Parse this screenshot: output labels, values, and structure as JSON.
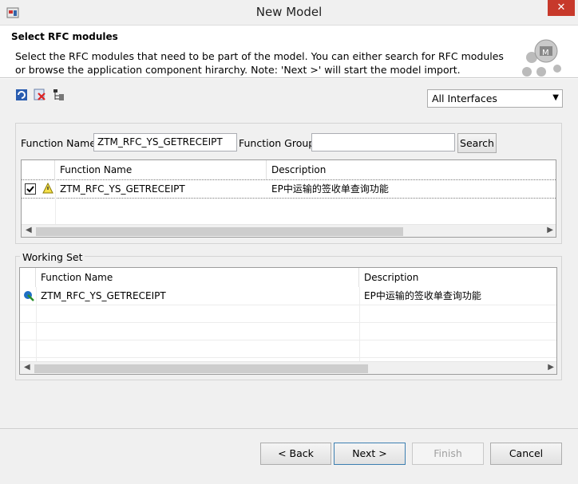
{
  "window": {
    "title": "New Model",
    "close_glyph": "✕"
  },
  "header": {
    "title": "Select RFC modules",
    "description": "Select the RFC modules that need to be part of the model. You can either search for RFC modules or browse the application component hirarchy. Note: 'Next >' will start the model import."
  },
  "toolbar": {
    "icons": [
      "refresh-icon",
      "delete-icon",
      "hierarchy-icon"
    ],
    "filter_selected": "All Interfaces"
  },
  "search": {
    "function_name_label": "Function Name",
    "function_name_value": "ZTM_RFC_YS_GETRECEIPT",
    "function_group_label": "Function Group",
    "function_group_value": "",
    "search_button": "Search"
  },
  "results_table": {
    "columns": [
      "Function Name",
      "Description"
    ],
    "rows": [
      {
        "checked": true,
        "name": "ZTM_RFC_YS_GETRECEIPT",
        "description": "EP中运输的签收单查询功能"
      }
    ]
  },
  "working_set": {
    "title": "Working Set",
    "columns": [
      "Function Name",
      "Description"
    ],
    "rows": [
      {
        "name": "ZTM_RFC_YS_GETRECEIPT",
        "description": "EP中运输的签收单查询功能"
      }
    ]
  },
  "buttons": {
    "back": "< Back",
    "next": "Next >",
    "finish": "Finish",
    "cancel": "Cancel"
  },
  "colors": {
    "close": "#c7392b",
    "focus": "#3c7fb1"
  }
}
